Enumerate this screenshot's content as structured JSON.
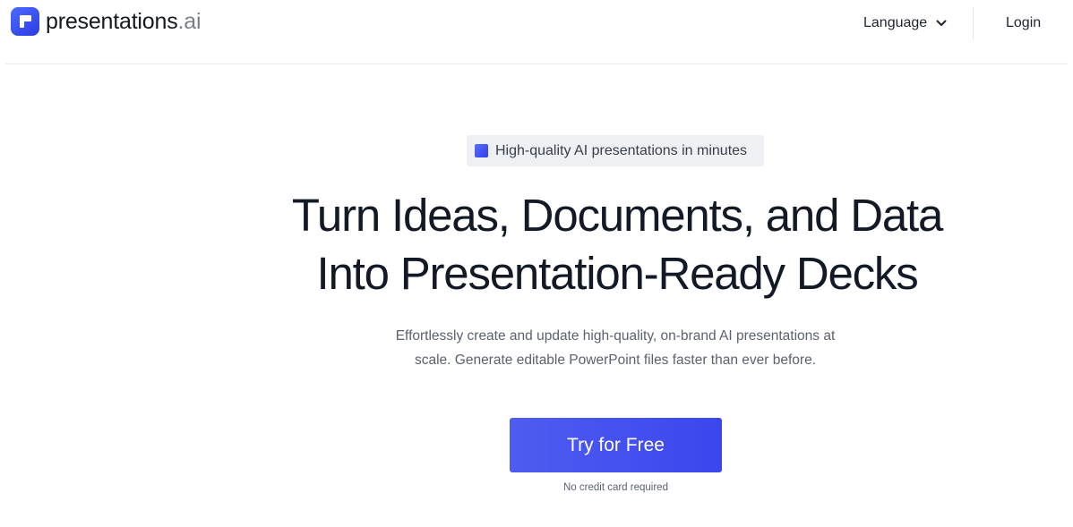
{
  "header": {
    "logo": {
      "name": "presentations",
      "suffix": ".ai",
      "icon": "presentations-logo-icon"
    },
    "language": {
      "label": "Language",
      "icon": "chevron-down-icon"
    },
    "login_label": "Login"
  },
  "hero": {
    "badge": {
      "icon": "blue-square-icon",
      "text": "High-quality AI presentations in minutes"
    },
    "title_lines": [
      "Turn Ideas, Documents, and Data",
      "Into Presentation-Ready Decks"
    ],
    "subtitle": "Effortlessly create and update high-quality, on-brand AI presentations at scale. Generate editable PowerPoint files faster than ever before.",
    "cta_label": "Try for Free",
    "cta_note": "No credit card required"
  },
  "colors": {
    "accent": "#3f4bef",
    "text": "#131a26",
    "muted": "#5b6170",
    "badge_bg": "#eef0f3"
  }
}
